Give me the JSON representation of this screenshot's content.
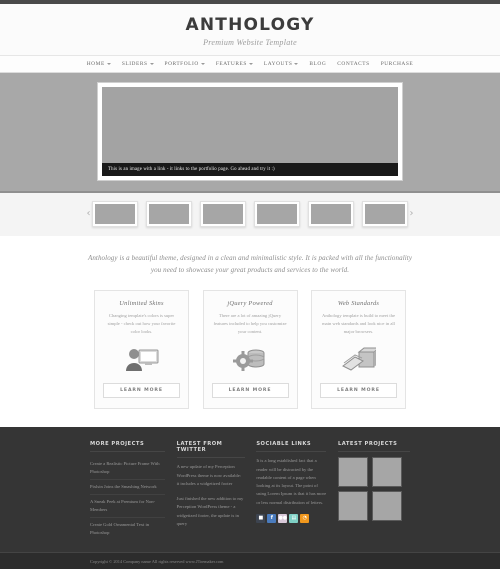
{
  "header": {
    "logo": "ANTHOLOGY",
    "tagline": "Premium Website Template"
  },
  "nav": {
    "items": [
      {
        "label": "HOME",
        "has_caret": true
      },
      {
        "label": "SLIDERS",
        "has_caret": true
      },
      {
        "label": "PORTFOLIO",
        "has_caret": true
      },
      {
        "label": "FEATURES",
        "has_caret": true
      },
      {
        "label": "LAYOUTS",
        "has_caret": true
      },
      {
        "label": "BLOG",
        "has_caret": false
      },
      {
        "label": "CONTACTS",
        "has_caret": false
      },
      {
        "label": "PURCHASE",
        "has_caret": false
      }
    ]
  },
  "slider": {
    "caption": "This is an image with a link - it links to the portfolio page. Go ahead and try it :)",
    "prev_arrow": "‹",
    "next_arrow": "›",
    "thumb_count": 6
  },
  "intro": {
    "text": "Anthology is a beautiful theme, designed in a clean and minimalistic style. It is packed with all the functionality you need to showcase your great products and services to the world."
  },
  "features": {
    "boxes": [
      {
        "title": "Unlimited Skins",
        "text": "Changing template's colors is super simple - check out how your favorite color looks.",
        "icon": "user-monitor-icon",
        "button": "LEARN MORE"
      },
      {
        "title": "jQuery Powered",
        "text": "There are a lot of amazing jQuery features included to help you customize your content.",
        "icon": "gear-database-icon",
        "button": "LEARN MORE"
      },
      {
        "title": "Web Standards",
        "text": "Anthology template is build to meet the main web standards and look nice in all major browsers.",
        "icon": "book-box-icon",
        "button": "LEARN MORE"
      }
    ]
  },
  "footer": {
    "more_projects": {
      "title": "MORE PROJECTS",
      "links": [
        "Create a Realistic Picture Frame With Photoshop",
        "Pixlsin Joins the Smashing Network",
        "A Sneak Peek at Premium for Non-Members",
        "Create Gold Ornamental Text in Photoshop"
      ]
    },
    "twitter": {
      "title": "LATEST FROM TWITTER",
      "tweets": [
        "A new update of my Perception WordPress theme is now available: it includes a widgetized footer",
        "Just finished the new addition to my Perception WordPress theme - a widgetized footer, the update is in query"
      ]
    },
    "sociable": {
      "title": "SOCIABLE LINKS",
      "text": "It is a long established fact that a reader will be distracted by the readable content of a page when looking at its layout. The point of using Lorem Ipsum is that it has more or less normal distribution of letters.",
      "icons": [
        {
          "name": "delicious-icon",
          "glyph": "■",
          "color": "#3d4450"
        },
        {
          "name": "facebook-icon",
          "glyph": "f",
          "color": "#4a7bbd"
        },
        {
          "name": "flickr-icon",
          "glyph": "●●",
          "color": "#d8c8d8"
        },
        {
          "name": "technorati-icon",
          "glyph": "▤",
          "color": "#7ecfc4"
        },
        {
          "name": "rss-icon",
          "glyph": "◔",
          "color": "#f0971d"
        }
      ]
    },
    "projects": {
      "title": "LATEST PROJECTS",
      "count": 4
    }
  },
  "copyright": {
    "text": "Copyright © 2014 Company name All rights reserved ",
    "link": "www.JToemaker.com"
  },
  "colors": {
    "dark_bar": "#4a4a4a",
    "slider_band": "#a8a8a8",
    "footer": "#353535",
    "copyright": "#2c2c2c"
  }
}
